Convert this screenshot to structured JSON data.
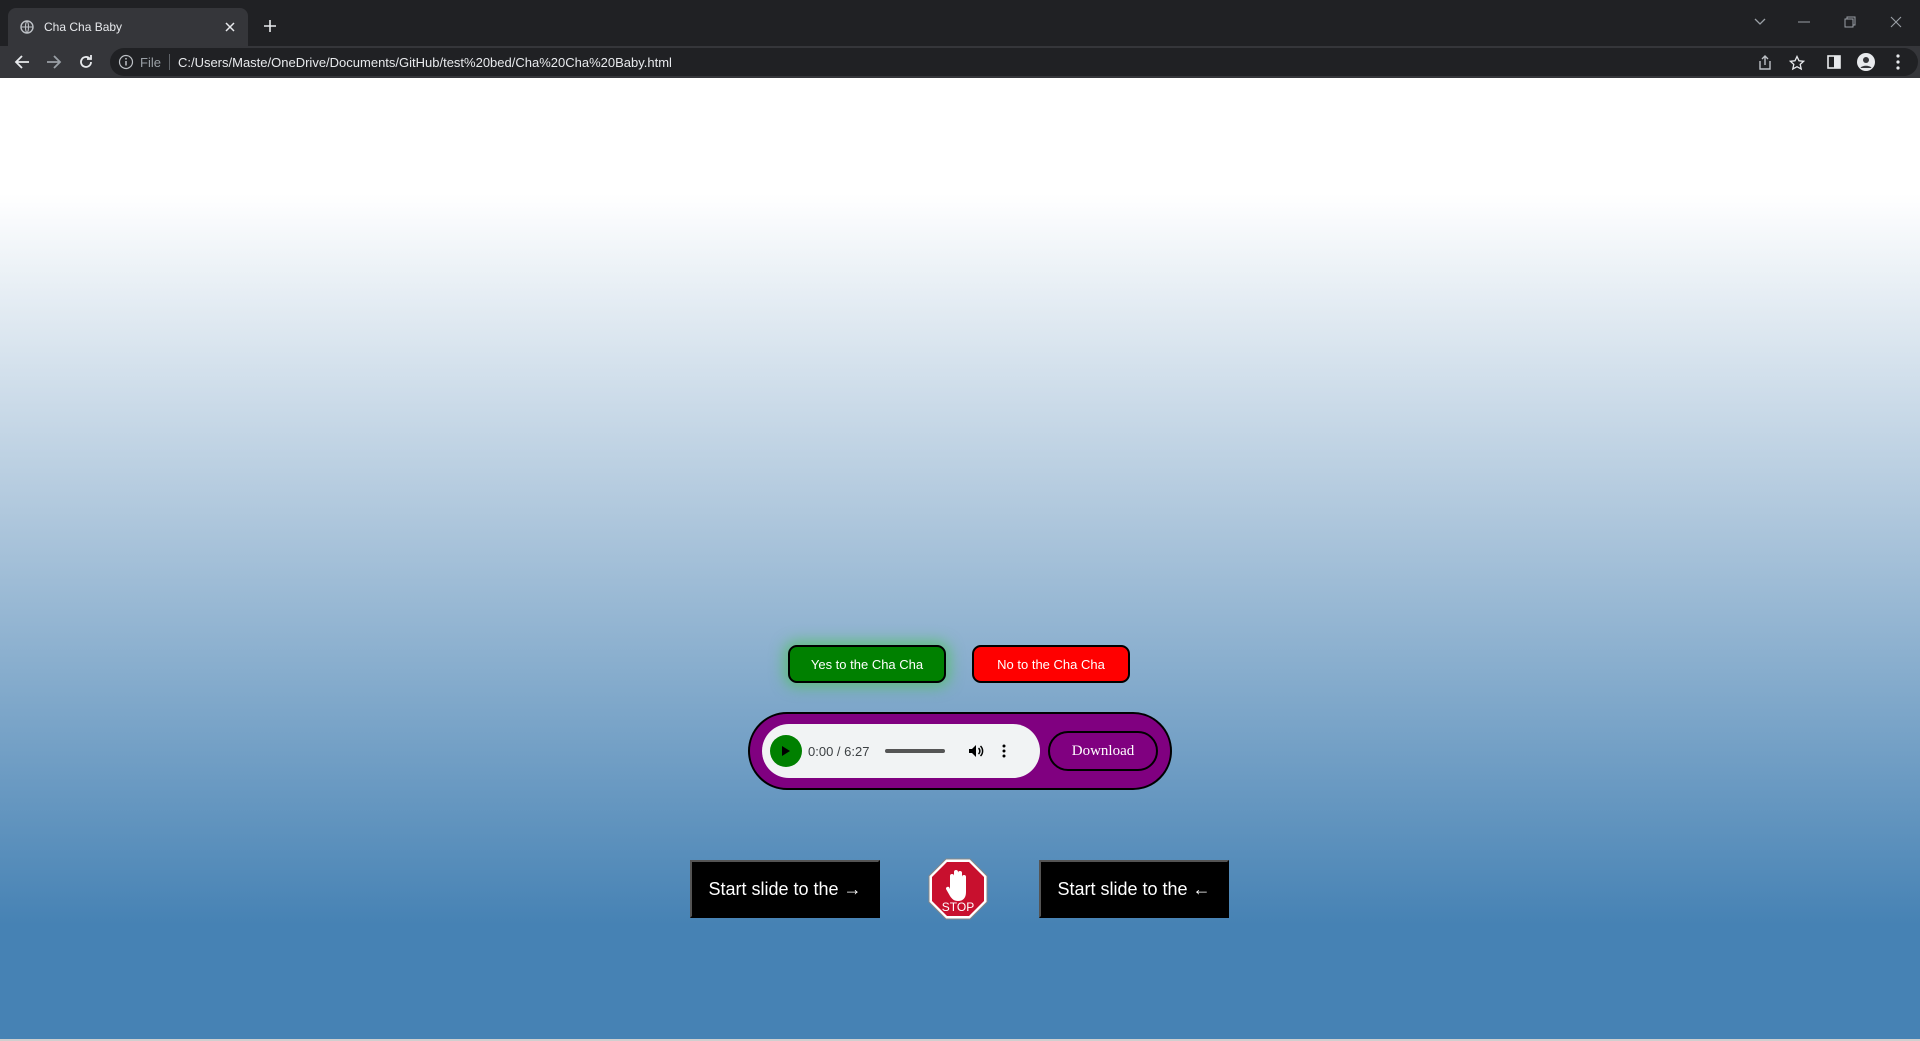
{
  "browser": {
    "tab": {
      "title": "Cha Cha Baby"
    },
    "address_bar": {
      "scheme_label": "File",
      "url": "C:/Users/Maste/OneDrive/Documents/GitHub/test%20bed/Cha%20Cha%20Baby.html"
    },
    "icons": [
      "globe-icon",
      "close-icon",
      "plus-icon",
      "back-arrow-icon",
      "forward-arrow-icon",
      "reload-icon",
      "info-icon",
      "share-icon",
      "star-icon",
      "side-panel-icon",
      "profile-icon",
      "kebab-menu-icon",
      "chevron-down-icon",
      "minimize-icon",
      "restore-icon",
      "close-window-icon"
    ]
  },
  "page": {
    "yes_button": "Yes to the Cha Cha",
    "no_button": "No to the Cha Cha",
    "audio": {
      "time": "0:00 / 6:27",
      "progress_fraction": 0
    },
    "download_button": "Download",
    "slide_right_button": "Start slide to the →",
    "slide_left_button": "Start slide to the ←",
    "stop_sign_text": "STOP"
  },
  "colors": {
    "yes": "#008000",
    "no": "#ff0000",
    "audio_frame": "#800080",
    "gradient_bottom": "#4682b4",
    "stop_sign": "#c8102e"
  }
}
